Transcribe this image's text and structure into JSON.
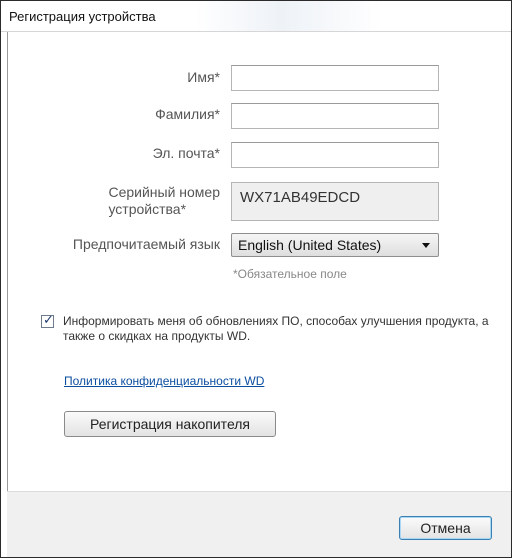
{
  "window": {
    "title": "Регистрация устройства"
  },
  "form": {
    "first_name": {
      "label": "Имя*",
      "value": "",
      "placeholder": ""
    },
    "last_name": {
      "label": "Фамилия*",
      "value": "",
      "placeholder": ""
    },
    "email": {
      "label": "Эл. почта*",
      "value": "",
      "placeholder": ""
    },
    "serial": {
      "label_line1": "Серийный номер",
      "label_line2": "устройства*",
      "value": "WX71AB49EDCD"
    },
    "language": {
      "label": "Предпочитаемый язык",
      "selected": "English (United States)"
    },
    "required_note": "*Обязательное поле"
  },
  "newsletter": {
    "checked": true,
    "text": "Информировать меня об обновлениях ПО, способах улучшения продукта, а также о скидках на продукты WD."
  },
  "privacy_link": "Политика конфиденциальности WD",
  "buttons": {
    "register": "Регистрация накопителя",
    "cancel": "Отмена"
  },
  "icons": {
    "checkbox_check": "check-icon",
    "dropdown": "chevron-down-icon"
  },
  "colors": {
    "link": "#0b4ea0",
    "cancel_focus_border": "#3c7fb1"
  }
}
